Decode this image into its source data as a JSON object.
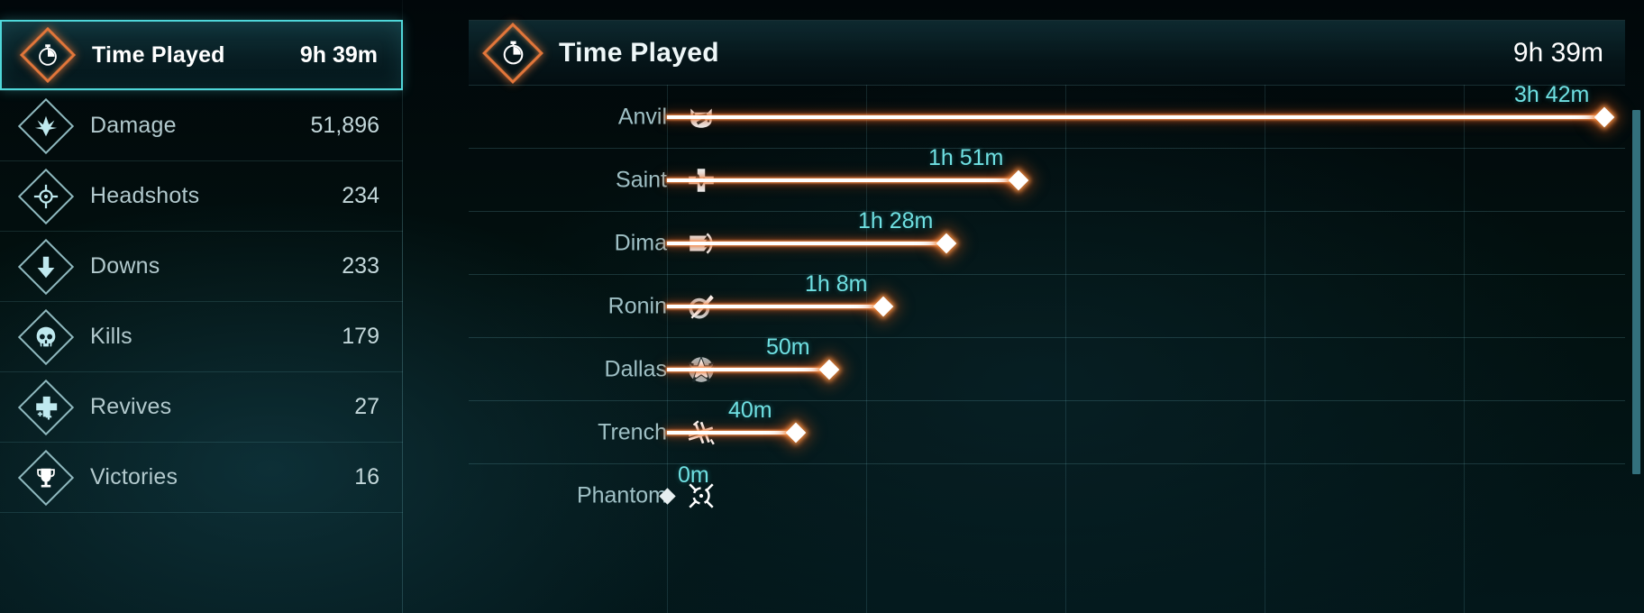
{
  "theme": {
    "accent_cyan": "#4fd7d9",
    "accent_orange": "#e2763a",
    "value_label_color": "#6fe0e2",
    "bar_color": "#ffffff",
    "background": "#01070a"
  },
  "sidebar": {
    "items": [
      {
        "label": "Time Played",
        "value": "9h 39m",
        "icon": "stopwatch-icon",
        "selected": true
      },
      {
        "label": "Damage",
        "value": "51,896",
        "icon": "burst-icon",
        "selected": false
      },
      {
        "label": "Headshots",
        "value": "234",
        "icon": "crosshair-icon",
        "selected": false
      },
      {
        "label": "Downs",
        "value": "233",
        "icon": "down-arrow-icon",
        "selected": false
      },
      {
        "label": "Kills",
        "value": "179",
        "icon": "skull-icon",
        "selected": false
      },
      {
        "label": "Revives",
        "value": "27",
        "icon": "medic-cross-icon",
        "selected": false
      },
      {
        "label": "Victories",
        "value": "16",
        "icon": "trophy-icon",
        "selected": false
      }
    ]
  },
  "panel": {
    "icon": "stopwatch-icon",
    "title": "Time Played",
    "total": "9h 39m"
  },
  "scrollbar": {
    "name": "chart-scrollbar"
  },
  "chart_data": {
    "type": "bar",
    "orientation": "horizontal",
    "title": "Time Played",
    "xlabel": "",
    "ylabel": "",
    "grid": true,
    "legend": false,
    "unit": "minutes",
    "xlim": [
      0,
      228
    ],
    "categories": [
      "Anvil",
      "Saint",
      "Dima",
      "Ronin",
      "Dallas",
      "Trench",
      "Phantom"
    ],
    "values": [
      222,
      111,
      88,
      68,
      50,
      40,
      0
    ],
    "value_labels": [
      "3h 42m",
      "1h 51m",
      "1h 28m",
      "1h 8m",
      "50m",
      "40m",
      "0m"
    ],
    "category_icons": [
      "anvil-helmet-icon",
      "saint-medic-cross-icon",
      "dima-shield-icon",
      "ronin-blade-icon",
      "dallas-star-icon",
      "trench-barbedwire-icon",
      "phantom-reticle-icon"
    ]
  }
}
